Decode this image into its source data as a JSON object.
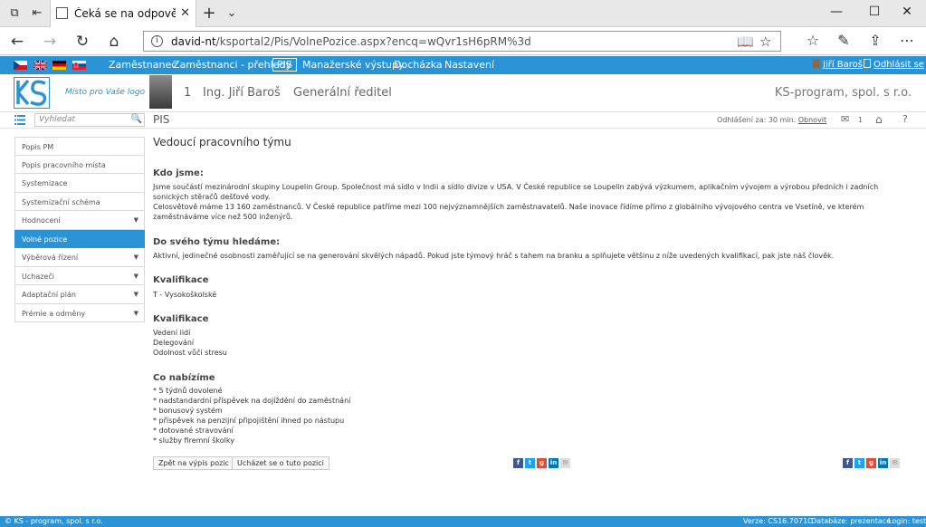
{
  "browser": {
    "tab_title": "Čeká se na odpověď ze",
    "url_host": "david-nt",
    "url_path": "/ksportal2/Pis/VolnePozice.aspx?encq=wQvr1sH6pRM%3d"
  },
  "topnav": {
    "items": [
      "Zaměstnanec",
      "Zaměstnanci - přehledy",
      "PIS",
      "Manažerské výstupy",
      "Docházka",
      "Nastavení"
    ],
    "user": "Jiří Baroš",
    "logout": "Odhlásit se"
  },
  "header": {
    "logo_tagline": "Místo pro Vaše logo",
    "number": "1",
    "name": "Ing. Jiří Baroš",
    "role": "Generální ředitel",
    "company": "KS-program, spol. s r.o."
  },
  "toolbar": {
    "search_placeholder": "Vyhledat",
    "section": "PIS",
    "logout_text": "Odhlášení za: 30 min.",
    "renew": "Obnovit",
    "mail_count": "1",
    "help": "?"
  },
  "sidebar": {
    "items": [
      {
        "label": "Popis PM",
        "arrow": false,
        "active": false
      },
      {
        "label": "Popis pracovního místa",
        "arrow": false,
        "active": false
      },
      {
        "label": "Systemizace",
        "arrow": false,
        "active": false
      },
      {
        "label": "Systemizační schéma",
        "arrow": false,
        "active": false
      },
      {
        "label": "Hodnocení",
        "arrow": true,
        "active": false
      },
      {
        "label": "Volné pozice",
        "arrow": false,
        "active": true
      },
      {
        "label": "Výběrová řízení",
        "arrow": true,
        "active": false
      },
      {
        "label": "Uchazeči",
        "arrow": true,
        "active": false
      },
      {
        "label": "Adaptační plán",
        "arrow": true,
        "active": false
      },
      {
        "label": "Prémie a odměny",
        "arrow": true,
        "active": false
      }
    ]
  },
  "content": {
    "title": "Vedoucí pracovního týmu",
    "kdo_heading": "Kdo jsme:",
    "kdo_p1": "Jsme součástí mezinárodní skupiny Loupelin Group. Společnost má sídlo v Indii a sídlo divize v USA. V České republice se Loupelin zabývá výzkumem, aplikačním vývojem a výrobou předních i zadních sonických stěračů dešťové vody.",
    "kdo_p2": "Celosvětově máme 13 160 zaměstnanců. V České republice patříme mezi 100 nejvýznamnějších zaměstnavatelů. Naše inovace řídíme přímo z globálního vývojového centra ve Vsetíně, ve kterém zaměstnáváme více než 500 inženýrů.",
    "hledame_heading": "Do svého týmu hledáme:",
    "hledame_p": "Aktivní, jedinečné osobnosti zaměřující se na generování skvělých nápadů. Pokud jste týmový hráč s tahem na branku a splňujete většinu z níže uvedených kvalifikací, pak jste náš člověk.",
    "kval1_heading": "Kvalifikace",
    "kval1_items": [
      "T - Vysokoškolské"
    ],
    "kval2_heading": "Kvalifikace",
    "kval2_items": [
      "Vedení lidí",
      "Delegování",
      "Odolnost vůči stresu"
    ],
    "nabizime_heading": "Co nabízíme",
    "nabizime_items": [
      "* 5 týdnů dovolené",
      "* nadstandardní příspěvek na dojíždění do zaměstnání",
      "* bonusový systém",
      "* příspěvek na penzijní připojištění ihned po nástupu",
      "* dotované stravování",
      "* služby firemní školky"
    ],
    "btn_back": "Zpět na výpis pozic",
    "btn_apply": "Ucházet se o tuto pozici"
  },
  "footer": {
    "copyright": "© KS - program, spol. s r.o.",
    "version": "Verze: CS16.7071C",
    "database": "Databáze: prezentace",
    "login": "Login: test"
  }
}
